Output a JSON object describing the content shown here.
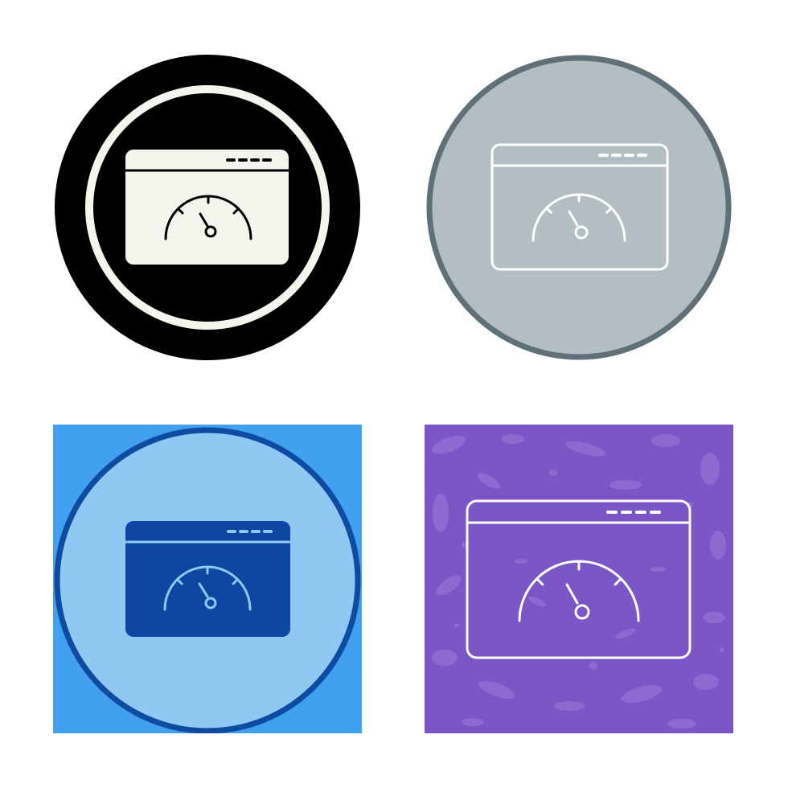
{
  "icons": [
    {
      "style": "glyph-black-circle",
      "icon": "browser-speedometer-icon",
      "colors": {
        "outer": "#000000",
        "ring": "#f5f5ee",
        "window": "#f5f5ee",
        "stroke": "#000000"
      }
    },
    {
      "style": "line-gray-circle",
      "icon": "browser-speedometer-icon",
      "colors": {
        "border": "#5f7078",
        "fill": "#b2bec1",
        "stroke": "#ffffff"
      }
    },
    {
      "style": "flat-blue-square",
      "icon": "browser-speedometer-icon",
      "colors": {
        "square": "#42a0f0",
        "circle": "#90c8f4",
        "circle_border": "#0d4ca0",
        "window": "#0d47a1",
        "stroke": "#90c8f4"
      }
    },
    {
      "style": "line-purple-texture",
      "icon": "browser-speedometer-icon",
      "colors": {
        "square": "#7b56c6",
        "texture": "#9470d4",
        "stroke": "#ffffff"
      }
    }
  ]
}
